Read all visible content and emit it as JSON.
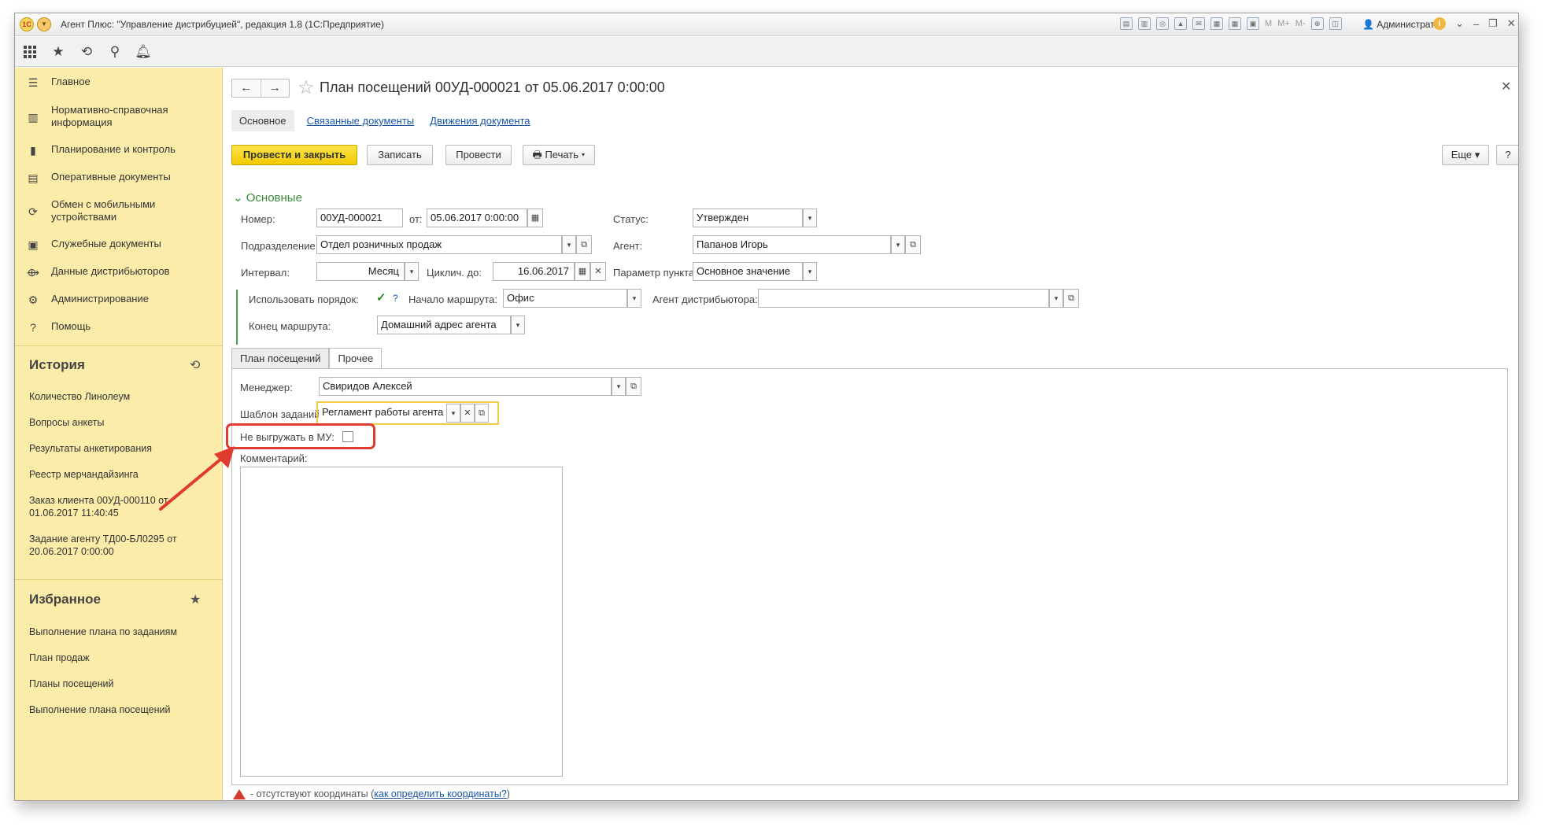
{
  "window": {
    "title": "Агент Плюс: \"Управление дистрибуцией\", редакция 1.8  (1С:Предприятие)",
    "logo_text": "1С",
    "user": "Администратор",
    "toolbar_m": [
      "M",
      "M+",
      "M-"
    ]
  },
  "sidebar": {
    "items": [
      {
        "label": "Главное",
        "icon": "menu-icon"
      },
      {
        "label": "Нормативно-справочная информация",
        "icon": "catalog-icon"
      },
      {
        "label": "Планирование и контроль",
        "icon": "chart-icon"
      },
      {
        "label": "Оперативные документы",
        "icon": "documents-icon"
      },
      {
        "label": "Обмен с мобильными устройствами",
        "icon": "sync-icon"
      },
      {
        "label": "Служебные документы",
        "icon": "service-docs-icon"
      },
      {
        "label": "Данные дистрибьюторов",
        "icon": "distributor-icon"
      },
      {
        "label": "Администрирование",
        "icon": "gear-icon"
      },
      {
        "label": "Помощь",
        "icon": "help-icon"
      }
    ],
    "history": {
      "title": "История",
      "items": [
        "Количество Линолеум",
        "Вопросы анкеты",
        "Результаты анкетирования",
        "Реестр мерчандайзинга",
        "Заказ клиента 00УД-000110 от 01.06.2017 11:40:45",
        "Задание агенту ТД00-БЛ0295 от 20.06.2017 0:00:00"
      ]
    },
    "favorites": {
      "title": "Избранное",
      "items": [
        "Выполнение плана по заданиям",
        "План продаж",
        "Планы посещений",
        "Выполнение плана посещений"
      ]
    }
  },
  "document": {
    "title": "План посещений 00УД-000021 от 05.06.2017 0:00:00",
    "tabs": [
      "Основное",
      "Связанные документы",
      "Движения документа"
    ],
    "buttons": {
      "post_close": "Провести и закрыть",
      "save": "Записать",
      "post": "Провести",
      "print": "Печать",
      "more": "Еще",
      "help": "?"
    },
    "section_title": "Основные",
    "fields": {
      "number_label": "Номер:",
      "number_value": "00УД-000021",
      "date_label": "от:",
      "date_value": "05.06.2017  0:00:00",
      "status_label": "Статус:",
      "status_value": "Утвержден",
      "department_label": "Подразделение:",
      "department_value": "Отдел розничных продаж",
      "agent_label": "Агент:",
      "agent_value": "Папанов Игорь",
      "interval_label": "Интервал:",
      "interval_value": "Месяц",
      "cyclic_label": "Циклич. до:",
      "cyclic_value": "16.06.2017",
      "point_param_label": "Параметр пункта:",
      "point_param_value": "Основное значение",
      "use_order_label": "Использовать порядок:",
      "route_start_label": "Начало маршрута:",
      "route_start_value": "Офис",
      "distributor_agent_label": "Агент дистрибьютора:",
      "distributor_agent_value": "",
      "route_end_label": "Конец маршрута:",
      "route_end_value": "Домашний адрес агента"
    },
    "inner_tabs": [
      "План посещений",
      "Прочее"
    ],
    "other": {
      "manager_label": "Менеджер:",
      "manager_value": "Свиридов Алексей",
      "template_label": "Шаблон заданий:",
      "template_value": "Регламент работы агента",
      "no_upload_label": "Не выгружать в МУ:",
      "comment_label": "Комментарий:"
    },
    "bottom_note": {
      "text": " - отсутствуют координаты (",
      "link": "как определить координаты?",
      "suffix": ")"
    }
  },
  "colors": {
    "sidebar_bg": "#fbecaa",
    "primary_button": "#f2c900",
    "section_green": "#3a8a3a",
    "link_blue": "#1a56a8",
    "highlight_red": "#e03b2e"
  }
}
